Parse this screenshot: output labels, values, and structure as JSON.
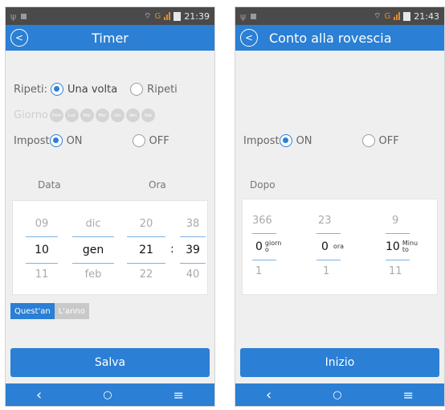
{
  "status_left": {
    "time": "21:39",
    "carrier": "G"
  },
  "status_right": {
    "time": "21:43",
    "carrier": "G"
  },
  "timer": {
    "title": "Timer",
    "repeat_label": "Ripeti:",
    "repeat_once": "Una volta",
    "repeat_repeat": "Ripeti",
    "day_label": "Giorno",
    "days": [
      "Dom",
      "Lun",
      "Mar",
      "Mer",
      "Gio",
      "Ven",
      "Sab"
    ],
    "impost_label": "Impost",
    "on_label": "ON",
    "off_label": "OFF",
    "date_header": "Data",
    "time_header": "Ora",
    "picker": {
      "day": [
        "09",
        "10",
        "11"
      ],
      "month": [
        "dic",
        "gen",
        "feb"
      ],
      "hour": [
        "20",
        "21",
        "22"
      ],
      "minute": [
        "38",
        "39",
        "40"
      ],
      "separator": ":"
    },
    "year_this": "Quest'an",
    "year_other": "L'anno",
    "save_label": "Salva"
  },
  "countdown": {
    "title": "Conto alla rovescia",
    "impost_label": "Impost",
    "on_label": "ON",
    "off_label": "OFF",
    "after_label": "Dopo",
    "picker": {
      "days": [
        "366",
        "0",
        "1"
      ],
      "days_unit_1": "giorn",
      "days_unit_2": "o",
      "hours": [
        "23",
        "0",
        "1"
      ],
      "hours_unit": "ora",
      "minutes": [
        "9",
        "10",
        "11"
      ],
      "minutes_unit_1": "Minu",
      "minutes_unit_2": "to"
    },
    "start_label": "Inizio"
  },
  "nav": {
    "back": "‹",
    "home": "○",
    "menu": "≡"
  },
  "colors": {
    "accent": "#2b7fd4",
    "status_bg": "#4a4a4a",
    "carrier": "#e58a2a"
  }
}
